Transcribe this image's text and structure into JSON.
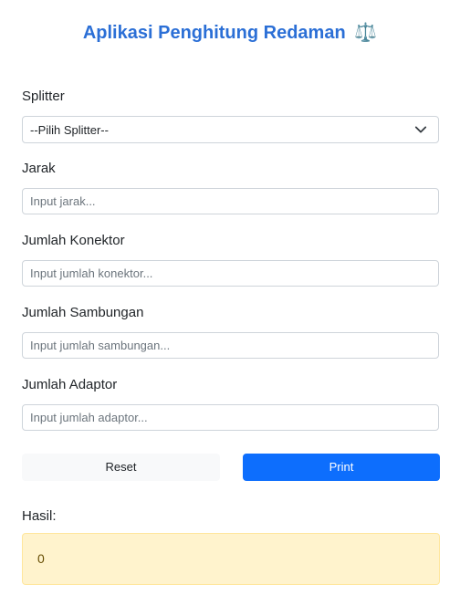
{
  "app": {
    "title": "Aplikasi Penghitung Redaman",
    "title_icon": "⚖️"
  },
  "form": {
    "splitter": {
      "label": "Splitter",
      "selected": "--Pilih Splitter--"
    },
    "jarak": {
      "label": "Jarak",
      "placeholder": "Input jarak..."
    },
    "konektor": {
      "label": "Jumlah Konektor",
      "placeholder": "Input jumlah konektor..."
    },
    "sambungan": {
      "label": "Jumlah Sambungan",
      "placeholder": "Input jumlah sambungan..."
    },
    "adaptor": {
      "label": "Jumlah Adaptor",
      "placeholder": "Input jumlah adaptor..."
    }
  },
  "buttons": {
    "reset_label": "Reset",
    "print_label": "Print"
  },
  "result": {
    "label": "Hasil:",
    "value": "0"
  },
  "colors": {
    "title": "#2b6fd6",
    "primary": "#0d6efd",
    "result_bg": "#fff3cd"
  }
}
